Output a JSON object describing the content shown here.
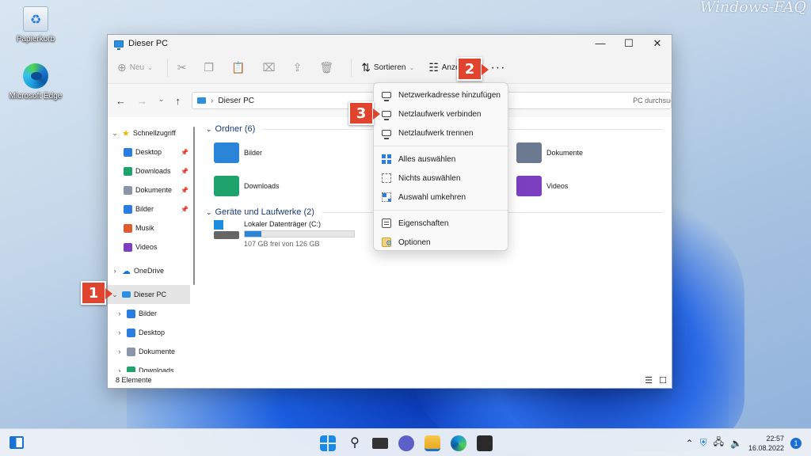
{
  "watermark": "Windows-FAQ",
  "desktop": {
    "recycle_bin": "Papierkorb",
    "edge": "Microsoft Edge"
  },
  "window": {
    "title": "Dieser PC",
    "controls": {
      "minimize": "—",
      "maximize": "☐",
      "close": "✕"
    }
  },
  "toolbar": {
    "new_label": "Neu",
    "sort_label": "Sortieren",
    "view_label": "Anzeigen",
    "more_label": "···"
  },
  "address": {
    "path": "Dieser PC",
    "search_placeholder": "PC durchsuchen"
  },
  "sidebar": {
    "quick_access": "Schnellzugriff",
    "quick_items": [
      {
        "label": "Desktop",
        "color": "#2a7de1"
      },
      {
        "label": "Downloads",
        "color": "#1da36b"
      },
      {
        "label": "Dokumente",
        "color": "#8a96a8"
      },
      {
        "label": "Bilder",
        "color": "#2a7de1"
      },
      {
        "label": "Musik",
        "color": "#e05a2e"
      },
      {
        "label": "Videos",
        "color": "#7b3fc0"
      }
    ],
    "onedrive": "OneDrive",
    "this_pc": "Dieser PC",
    "pc_items": [
      {
        "label": "Bilder",
        "color": "#2a7de1"
      },
      {
        "label": "Desktop",
        "color": "#2a7de1"
      },
      {
        "label": "Dokumente",
        "color": "#8a96a8"
      },
      {
        "label": "Downloads",
        "color": "#1da36b"
      }
    ]
  },
  "content": {
    "folders_header": "Ordner (6)",
    "folders": [
      {
        "label": "Bilder",
        "color": "#2a84d8"
      },
      {
        "label": "Dokumente",
        "color": "#6b7a90"
      },
      {
        "label": "Downloads",
        "color": "#1da36b"
      },
      {
        "label": "Videos",
        "color": "#7b3fc0"
      }
    ],
    "drives_header": "Geräte und Laufwerke (2)",
    "drive": {
      "name": "Lokaler Datenträger (C:)",
      "free": "107 GB frei von 126 GB",
      "used_fraction": 0.15
    }
  },
  "status": {
    "count": "8 Elemente",
    "view_details": "☰",
    "view_tiles": "☐"
  },
  "menu": {
    "items": [
      {
        "label": "Netzwerkadresse hinzufügen",
        "icon": "network-location-icon"
      },
      {
        "label": "Netzlaufwerk verbinden",
        "icon": "map-network-drive-icon"
      },
      {
        "label": "Netzlaufwerk trennen",
        "icon": "disconnect-network-drive-icon"
      },
      {
        "label": "Alles auswählen",
        "icon": "select-all-icon"
      },
      {
        "label": "Nichts auswählen",
        "icon": "select-none-icon"
      },
      {
        "label": "Auswahl umkehren",
        "icon": "invert-selection-icon"
      },
      {
        "label": "Eigenschaften",
        "icon": "properties-icon"
      },
      {
        "label": "Optionen",
        "icon": "options-icon"
      }
    ]
  },
  "callouts": {
    "one": "1",
    "two": "2",
    "three": "3"
  },
  "taskbar": {
    "time": "22:57",
    "date": "16.08.2022",
    "notifications": "1"
  }
}
